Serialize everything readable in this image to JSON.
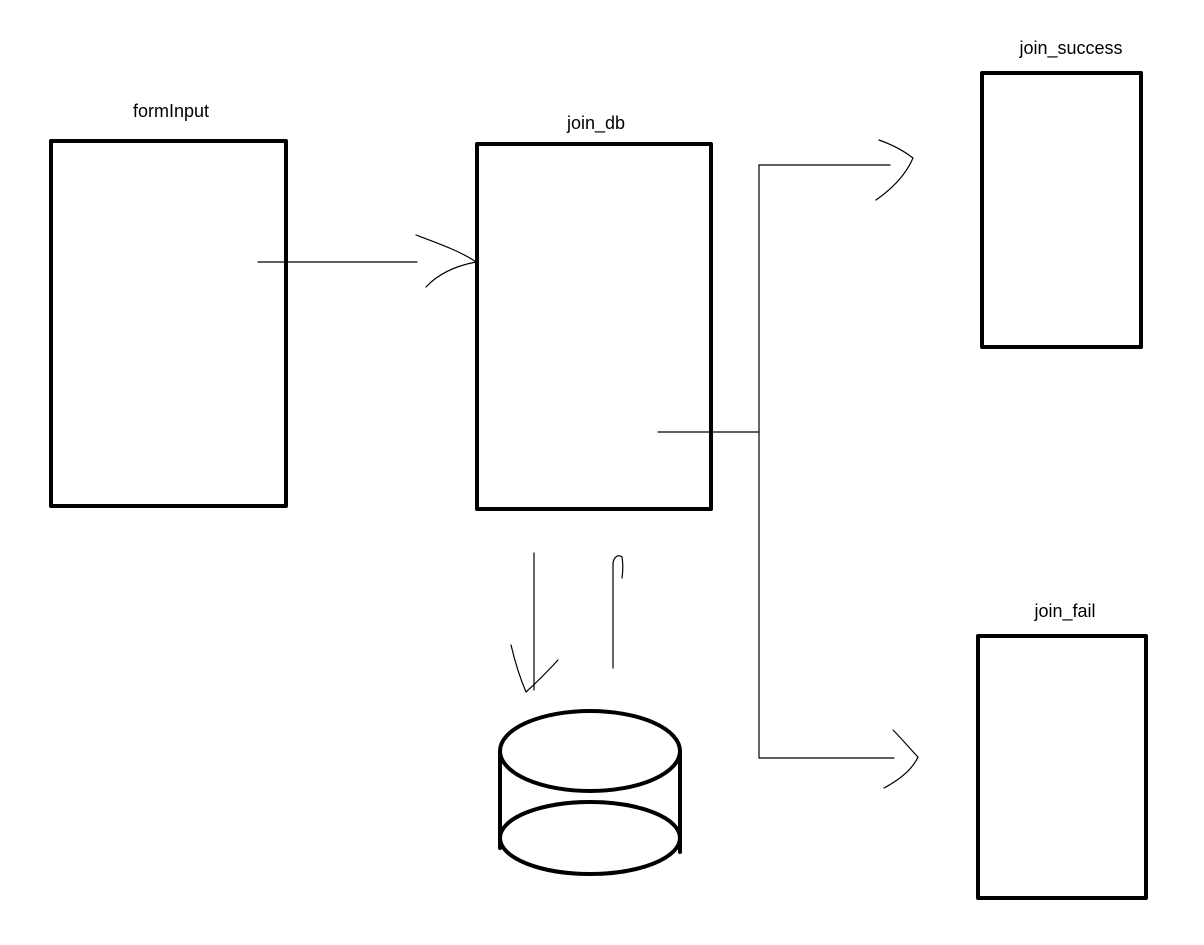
{
  "labels": {
    "form_input": "formInput",
    "join_db": "join_db",
    "join_success": "join_success",
    "join_fail": "join_fail"
  },
  "colors": {
    "stroke": "#000000",
    "background": "#ffffff"
  }
}
